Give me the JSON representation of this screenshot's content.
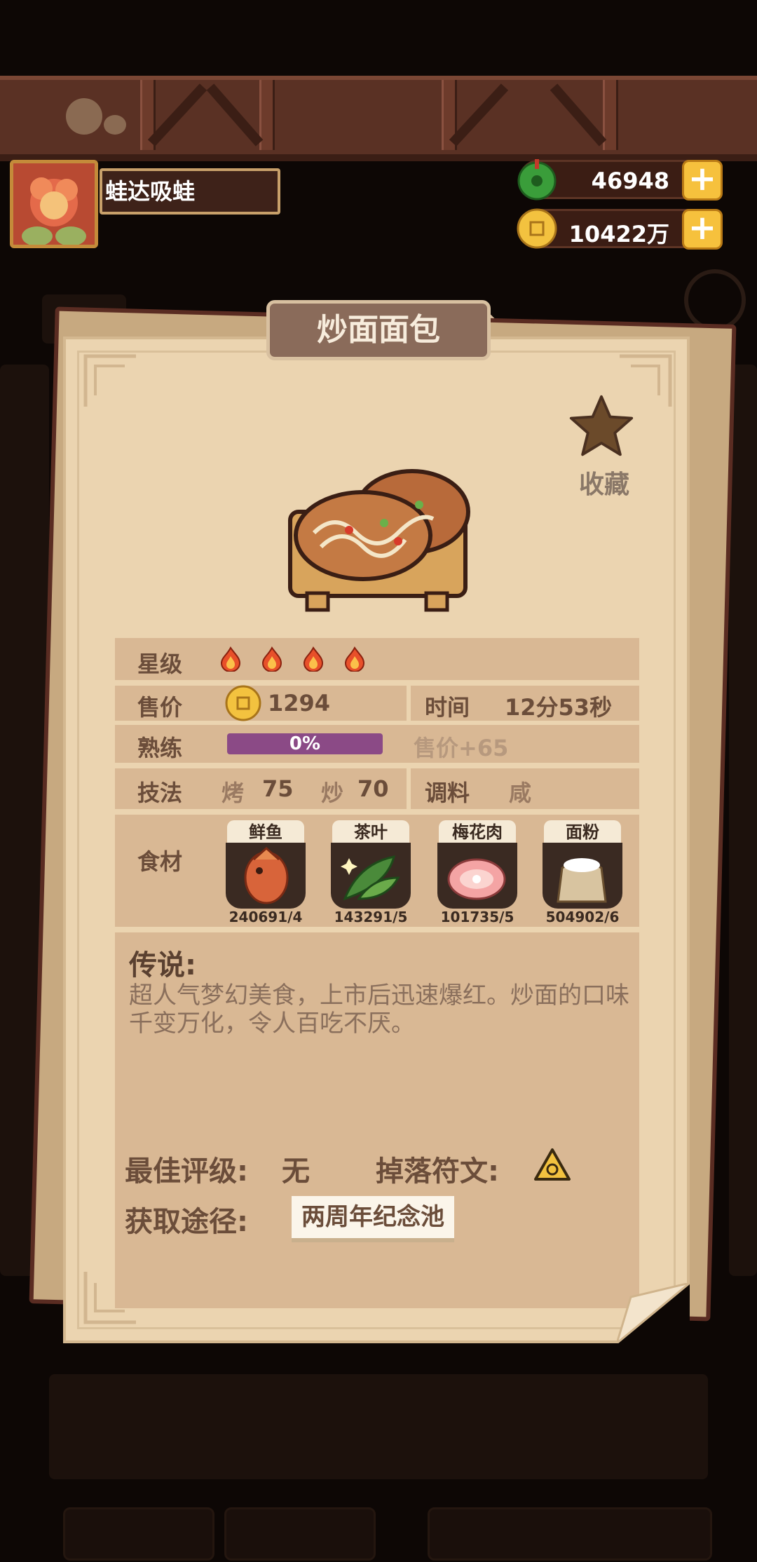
{
  "player": {
    "name": "蛙达吸蛙"
  },
  "currency": {
    "jade": {
      "value": "46948",
      "icon": "jade-icon"
    },
    "coin": {
      "value": "10422万",
      "icon": "coin-icon"
    },
    "plus_label": "+"
  },
  "card": {
    "title": "炒面面包",
    "favorite_label": "收藏",
    "stats": {
      "star_label": "星级",
      "star_count": 4,
      "price_label": "售价",
      "price_value": "1294",
      "time_label": "时间",
      "time_value": "12分53秒",
      "skill_label": "熟练",
      "skill_progress": "0%",
      "skill_bonus": "售价+65",
      "technique_label": "技法",
      "technique_1_name": "烤",
      "technique_1_value": "75",
      "technique_2_name": "炒",
      "technique_2_value": "70",
      "seasoning_label": "调料",
      "seasoning_value": "咸"
    },
    "ingredients_label": "食材",
    "ingredients": [
      {
        "name": "鲜鱼",
        "count": "240691/4",
        "icon": "fish-icon"
      },
      {
        "name": "茶叶",
        "count": "143291/5",
        "icon": "tea-leaf-icon"
      },
      {
        "name": "梅花肉",
        "count": "101735/5",
        "icon": "pork-icon"
      },
      {
        "name": "面粉",
        "count": "504902/6",
        "icon": "flour-sack-icon"
      }
    ],
    "legend_title": "传说:",
    "legend_text": "超人气梦幻美食，上市后迅速爆红。炒面的口味千变万化，令人百吃不厌。",
    "best_rating_label": "最佳评级:",
    "best_rating_value": "无",
    "rune_label": "掉落符文:",
    "source_label": "获取途径:",
    "source_value": "两周年纪念池"
  },
  "colors": {
    "paper": "#ebd4b0",
    "row": "#d9b894",
    "progress": "#8b4a86",
    "plus": "#f6c13d"
  }
}
